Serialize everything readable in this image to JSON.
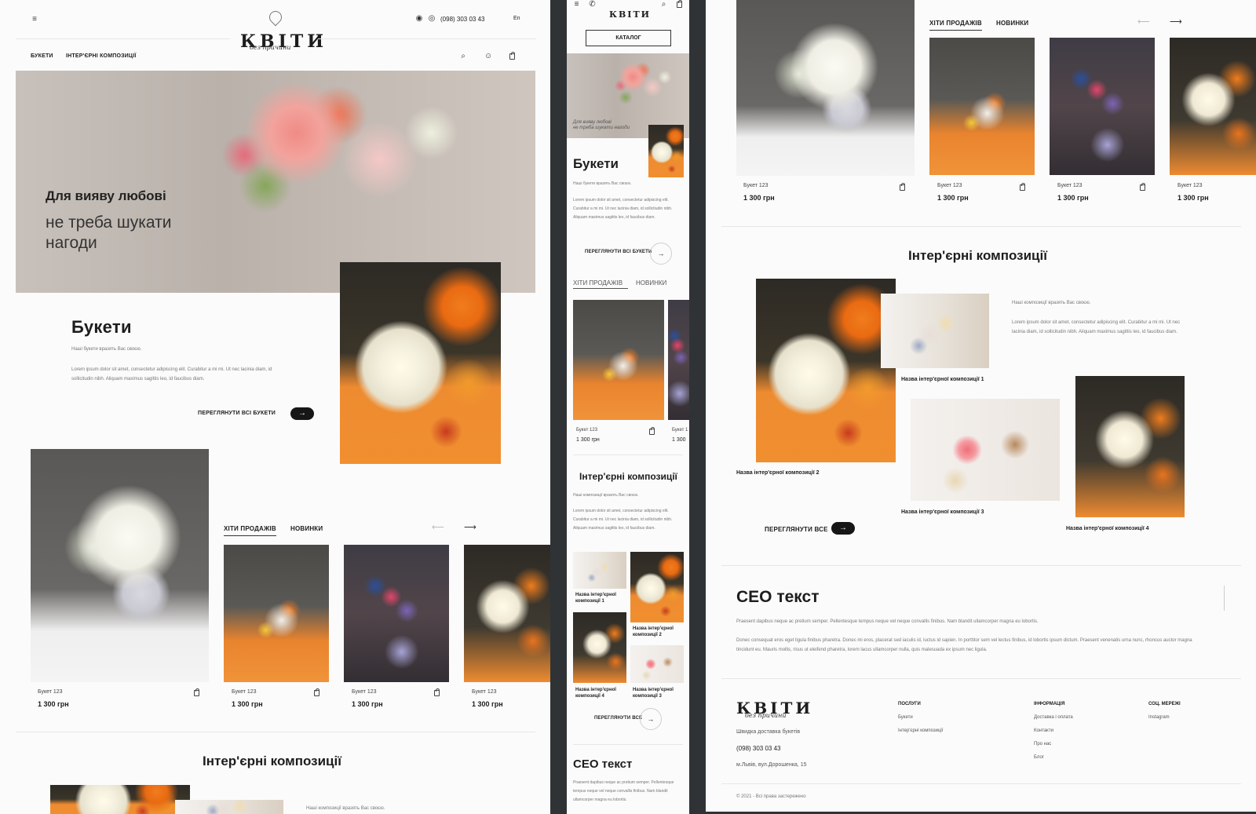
{
  "brand": {
    "name": "КВІТИ",
    "tagline": "без причини"
  },
  "header": {
    "phone": "(098) 303 03 43",
    "lang": "En",
    "nav": [
      "БУКЕТИ",
      "ІНТЕР'ЄРНІ КОМПОЗИЦІЇ"
    ]
  },
  "hero": {
    "line1": "Для вияву любові",
    "line2": "не треба шукати",
    "line3": "нагоди"
  },
  "bouquets": {
    "title": "Букети",
    "subtitle": "Наші букети вразять Вас своєю.",
    "body": "Lorem ipsum dolor sit amet, consectetur adipiscing elit. Curabitur a mi mi. Ut nec lacinia diam, id sollicitudin nibh. Aliquam maximus sagittis leo, id faucibus diam.",
    "cta": "ПЕРЕГЛЯНУТИ ВСІ БУКЕТИ",
    "cta_arrow": "→"
  },
  "tabs": {
    "hits": "ХІТИ ПРОДАЖІВ",
    "new": "НОВИНКИ",
    "prev": "⟵",
    "next": "⟶"
  },
  "products": [
    {
      "name": "Букет 123",
      "price": "1 300 грн"
    },
    {
      "name": "Букет 123",
      "price": "1 300 грн"
    },
    {
      "name": "Букет 123",
      "price": "1 300 грн"
    },
    {
      "name": "Букет 123",
      "price": "1 300 грн"
    }
  ],
  "interior": {
    "title": "Інтер'єрні  композиції",
    "subtitle": "Наші композиції вразять Вас своєю.",
    "body": "Lorem ipsum dolor sit amet, consectetur adipiscing elit. Curabitur a mi mi. Ut nec lacinia diam, id sollicitudin nibh. Aliquam maximus sagittis leo, id faucibus diam.",
    "cta": "ПЕРЕГЛЯНУТИ ВСЕ",
    "cta_arrow": "→",
    "items": [
      "Назва інтер'єрної композиції 1",
      "Назва інтер'єрної композиції 2",
      "Назва інтер'єрної композиції 3",
      "Назва інтер'єрної композиції 4"
    ]
  },
  "seo": {
    "title": "СЕО текст",
    "p1": "Praesent dapibus neque ac pretium semper. Pellentesque tempus neque vel neque convallis finibus. Nam blandit ullamcorper magna eu lobortis.",
    "p2": "Donec consequat eros eget ligula finibus pharetra. Donec mi eros, placerat sed iaculis id, luctus id sapien. In porttitor sem vel lectus finibus, id lobortis ipsum dictum. Praesent venenatis urna nunc, rhoncus auctor magna tincidunt eu. Mauris mollis, risus ut eleifend pharetra, lorem lacus ullamcorper nulla, quis malesuada ex ipsum nec ligula."
  },
  "mobile": {
    "catalog": "КАТАЛОГ",
    "hero_caption1": "Для вияву любові",
    "hero_caption2": "не треба шукати нагоди",
    "bouquets_title": "Букети",
    "interior_title": "Інтер'єрні  композиції",
    "mini_items": [
      "Назва інтер'єрної композиції 1",
      "Назва інтер'єрної композиції 2",
      "Назва інтер'єрної композиції 4",
      "Назва інтер'єрної композиції 3"
    ],
    "price_cut": "1 300",
    "name_cut": "Букет 1",
    "cta_bouquets": "ПЕРЕГЛЯНУТИ ВСІ БУКЕТИ",
    "cta_interior": "ПЕРЕГЛЯНУТИ ВСЕ",
    "seo_title": "СЕО текст",
    "seo_body": "Praesent dapibus neque ac pretium semper. Pellentesque tempus neque vel neque convallis finibus. Nam blandit ullamcorper magna eu lobortis."
  },
  "footer": {
    "tagline": "Швидка доставка букетів",
    "phone": "(098) 303 03 43",
    "address": "м.Львів, вул.Дорошенка, 15",
    "copyright": "© 2021 - Всі права застережено",
    "cols": [
      {
        "title": "ПОСЛУГИ",
        "items": [
          "Букети",
          "Інтер'єрні композиції"
        ]
      },
      {
        "title": "ІНФОРМАЦІЯ",
        "items": [
          "Доставка і оплата",
          "Контакти",
          "Про нас",
          "Блог"
        ]
      },
      {
        "title": "СОЦ. МЕРЕЖІ",
        "items": [
          "Instagram"
        ]
      }
    ]
  }
}
